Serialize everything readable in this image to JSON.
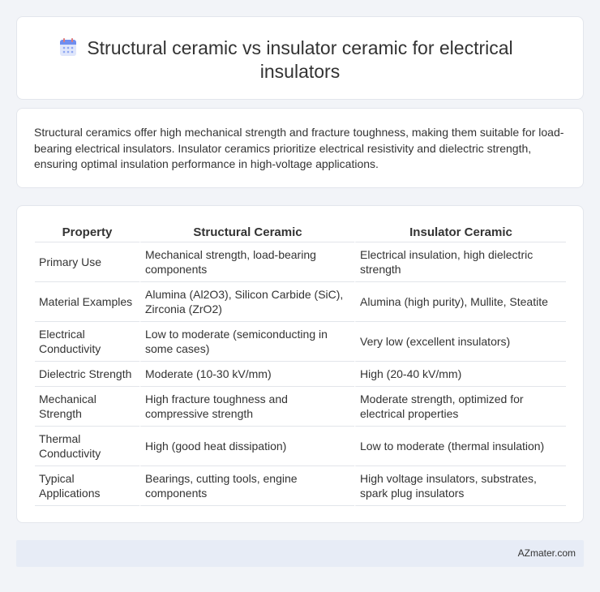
{
  "header": {
    "title": "Structural ceramic vs insulator ceramic for electrical insulators",
    "icon": "calendar-icon"
  },
  "summary": {
    "text": "Structural ceramics offer high mechanical strength and fracture toughness, making them suitable for load-bearing electrical insulators. Insulator ceramics prioritize electrical resistivity and dielectric strength, ensuring optimal insulation performance in high-voltage applications."
  },
  "table": {
    "headers": [
      "Property",
      "Structural Ceramic",
      "Insulator Ceramic"
    ],
    "rows": [
      [
        "Primary Use",
        "Mechanical strength, load-bearing components",
        "Electrical insulation, high dielectric strength"
      ],
      [
        "Material Examples",
        "Alumina (Al2O3), Silicon Carbide (SiC), Zirconia (ZrO2)",
        "Alumina (high purity), Mullite, Steatite"
      ],
      [
        "Electrical Conductivity",
        "Low to moderate (semiconducting in some cases)",
        "Very low (excellent insulators)"
      ],
      [
        "Dielectric Strength",
        "Moderate (10-30 kV/mm)",
        "High (20-40 kV/mm)"
      ],
      [
        "Mechanical Strength",
        "High fracture toughness and compressive strength",
        "Moderate strength, optimized for electrical properties"
      ],
      [
        "Thermal Conductivity",
        "High (good heat dissipation)",
        "Low to moderate (thermal insulation)"
      ],
      [
        "Typical Applications",
        "Bearings, cutting tools, engine components",
        "High voltage insulators, substrates, spark plug insulators"
      ]
    ]
  },
  "footer": {
    "brand": "AZmater.com"
  }
}
